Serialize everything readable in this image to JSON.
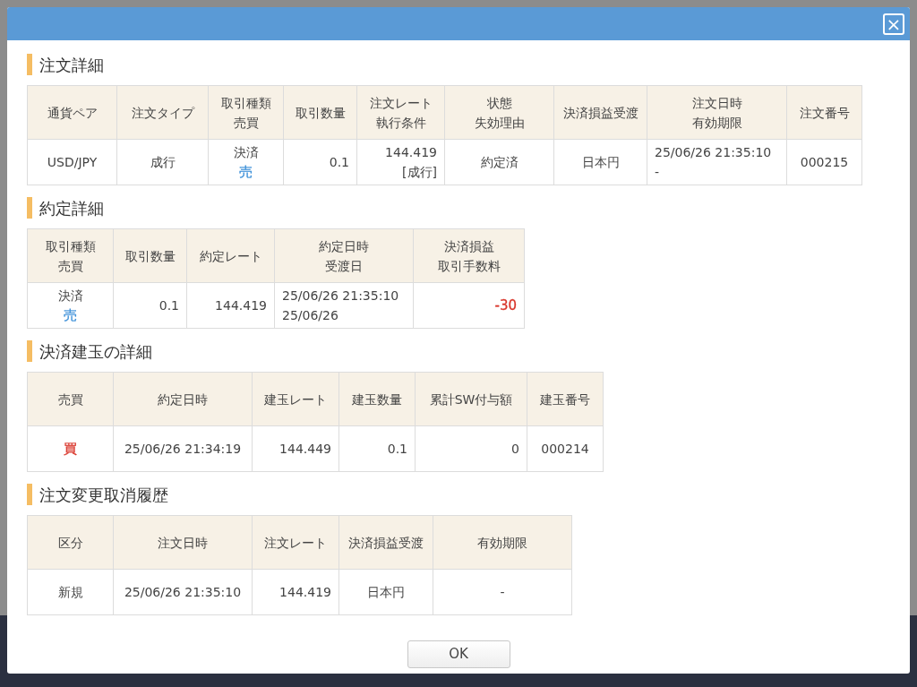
{
  "dialog": {
    "close": "×",
    "sections": [
      {
        "title": "注文詳細",
        "headers": [
          [
            "通貨ペア"
          ],
          [
            "注文タイプ"
          ],
          [
            "取引種類",
            "売買"
          ],
          [
            "取引数量"
          ],
          [
            "注文レート",
            "執行条件"
          ],
          [
            "状態",
            "失効理由"
          ],
          [
            "決済損益受渡"
          ],
          [
            "注文日時",
            "有効期限"
          ],
          [
            "注文番号"
          ]
        ],
        "rows": [
          [
            [
              {
                "text": "USD/JPY"
              }
            ],
            [
              {
                "text": "成行"
              }
            ],
            [
              {
                "text": "決済"
              },
              {
                "text": "売",
                "color": "#3b8fd8"
              }
            ],
            [
              {
                "text": "0.1"
              }
            ],
            [
              {
                "text": "144.419"
              },
              {
                "text": "[成行]"
              }
            ],
            [
              {
                "text": "約定済"
              }
            ],
            [
              {
                "text": "日本円"
              }
            ],
            [
              {
                "text": "25/06/26 21:35:10"
              },
              {
                "text": "-"
              }
            ],
            [
              {
                "text": "000215"
              }
            ]
          ]
        ]
      },
      {
        "title": "約定詳細",
        "headers": [
          [
            "取引種類",
            "売買"
          ],
          [
            "取引数量"
          ],
          [
            "約定レート"
          ],
          [
            "約定日時",
            "受渡日"
          ],
          [
            "決済損益",
            "取引手数料"
          ]
        ],
        "rows": [
          [
            [
              {
                "text": "決済"
              },
              {
                "text": "売",
                "color": "#3b8fd8"
              }
            ],
            [
              {
                "text": "0.1"
              }
            ],
            [
              {
                "text": "144.419"
              }
            ],
            [
              {
                "text": "25/06/26 21:35:10"
              },
              {
                "text": "25/06/26"
              }
            ],
            [
              {
                "text": "-30",
                "color": "#d9362b"
              }
            ]
          ]
        ]
      },
      {
        "title": "決済建玉の詳細",
        "headers": [
          [
            "売買"
          ],
          [
            "約定日時"
          ],
          [
            "建玉レート"
          ],
          [
            "建玉数量"
          ],
          [
            "累計SW付与額"
          ],
          [
            "建玉番号"
          ]
        ],
        "rows": [
          [
            [
              {
                "text": "買",
                "color": "#d9362b"
              }
            ],
            [
              {
                "text": "25/06/26 21:34:19"
              }
            ],
            [
              {
                "text": "144.449"
              }
            ],
            [
              {
                "text": "0.1"
              }
            ],
            [
              {
                "text": "0"
              }
            ],
            [
              {
                "text": "000214"
              }
            ]
          ]
        ]
      },
      {
        "title": "注文変更取消履歴",
        "headers": [
          [
            "区分"
          ],
          [
            "注文日時"
          ],
          [
            "注文レート"
          ],
          [
            "決済損益受渡"
          ],
          [
            "有効期限"
          ]
        ],
        "rows": [
          [
            [
              {
                "text": "新規"
              }
            ],
            [
              {
                "text": "25/06/26 21:35:10"
              }
            ],
            [
              {
                "text": "144.419"
              }
            ],
            [
              {
                "text": "日本円"
              }
            ],
            [
              {
                "text": "-"
              }
            ]
          ]
        ]
      }
    ],
    "ok": "OK"
  }
}
